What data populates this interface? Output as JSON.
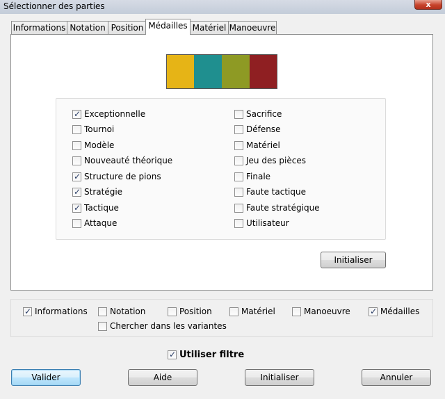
{
  "window": {
    "title": "Sélectionner des parties",
    "close_label": "x"
  },
  "tabs": [
    {
      "label": "Informations"
    },
    {
      "label": "Notation"
    },
    {
      "label": "Position"
    },
    {
      "label": "Médailles",
      "active": true
    },
    {
      "label": "Matériel"
    },
    {
      "label": "Manoeuvre"
    }
  ],
  "medal_colors": [
    "#e6b416",
    "#1f8f8f",
    "#8e9a24",
    "#8f1f22"
  ],
  "medals_left": [
    {
      "label": "Exceptionnelle",
      "checked": true
    },
    {
      "label": "Tournoi",
      "checked": false
    },
    {
      "label": "Modèle",
      "checked": false
    },
    {
      "label": "Nouveauté théorique",
      "checked": false
    },
    {
      "label": "Structure de pions",
      "checked": true
    },
    {
      "label": "Stratégie",
      "checked": true
    },
    {
      "label": "Tactique",
      "checked": true
    },
    {
      "label": "Attaque",
      "checked": false
    }
  ],
  "medals_right": [
    {
      "label": "Sacrifice",
      "checked": false
    },
    {
      "label": "Défense",
      "checked": false
    },
    {
      "label": "Matériel",
      "checked": false
    },
    {
      "label": "Jeu des pièces",
      "checked": false
    },
    {
      "label": "Finale",
      "checked": false
    },
    {
      "label": "Faute tactique",
      "checked": false
    },
    {
      "label": "Faute stratégique",
      "checked": false
    },
    {
      "label": "Utilisateur",
      "checked": false
    }
  ],
  "panel_reset_label": "Initialiser",
  "filters": [
    {
      "label": "Informations",
      "checked": true
    },
    {
      "label": "Notation",
      "checked": false
    },
    {
      "label": "Position",
      "checked": false
    },
    {
      "label": "Matériel",
      "checked": false
    },
    {
      "label": "Manoeuvre",
      "checked": false
    },
    {
      "label": "Médailles",
      "checked": true
    }
  ],
  "search_variants": {
    "label": "Chercher dans les variantes",
    "checked": false
  },
  "use_filter": {
    "label": "Utiliser filtre",
    "checked": true
  },
  "buttons": {
    "validate": "Valider",
    "help": "Aide",
    "reset": "Initialiser",
    "cancel": "Annuler"
  }
}
